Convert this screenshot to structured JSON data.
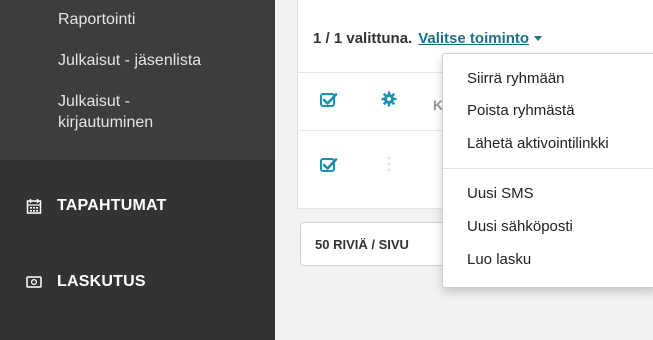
{
  "sidebar": {
    "sub_items": [
      "Raportointi",
      "Julkaisut - jäsenlista",
      "Julkaisut -",
      "kirjautuminen"
    ],
    "nav_items": [
      {
        "label": "TAPAHTUMAT",
        "icon": "calendar-icon"
      },
      {
        "label": "LASKUTUS",
        "icon": "invoice-icon"
      }
    ]
  },
  "selection": {
    "count_text": "1 / 1 valittuna.",
    "action_label": "Valitse toiminto"
  },
  "table": {
    "column_fragment": "K"
  },
  "pagination": {
    "rows_per_page_label": "50 RIVIÄ / SIVU"
  },
  "dropdown": {
    "items": [
      "Siirrä ryhmään",
      "Poista ryhmästä",
      "Lähetä aktivointilinkki",
      "Uusi SMS",
      "Uusi sähköposti",
      "Luo lasku"
    ]
  },
  "colors": {
    "sidebar_bg": "#333333",
    "accent_teal": "#1f8fae",
    "link_color": "#1f6f8b"
  }
}
